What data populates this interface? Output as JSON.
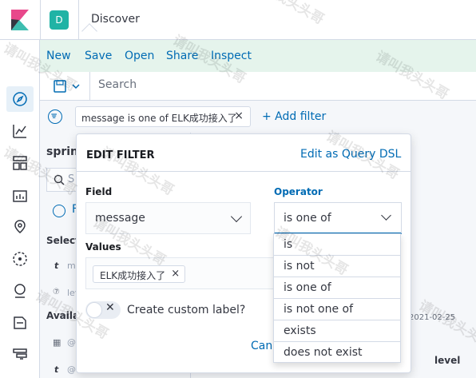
{
  "header": {
    "space_initial": "D",
    "page_title": "Discover"
  },
  "toolbar": {
    "new_label": "New",
    "save_label": "Save",
    "open_label": "Open",
    "share_label": "Share",
    "inspect_label": "Inspect"
  },
  "query_bar": {
    "placeholder": "Search"
  },
  "filter_bar": {
    "pill_text": "message is one of ELK成功接入了",
    "pill_close": "×",
    "add_filter_label": "+ Add filter"
  },
  "background": {
    "index_name": "spring",
    "search_glyph": "S",
    "filter_letter": "F",
    "selected_label": "Select",
    "field_type_t": "t",
    "field_m": "m",
    "field_type_q": "⑦",
    "field_lev": "lev",
    "available_label": "Availa",
    "date_type": "▦",
    "field_at1": "@",
    "field_type_t2": "t",
    "field_at2": "@",
    "date_text": "2021-02-25",
    "level_header": "level"
  },
  "edit_filter": {
    "title": "EDIT FILTER",
    "edit_dsl_label": "Edit as Query DSL",
    "field_label": "Field",
    "field_value": "message",
    "operator_label": "Operator",
    "operator_value": "is one of",
    "values_label": "Values",
    "value_chips": [
      "ELK成功接入了"
    ],
    "chip_close": "×",
    "toggle_off_glyph": "✕",
    "custom_label_text": "Create custom label?",
    "cancel_label": "Can"
  },
  "operator_options": [
    "is",
    "is not",
    "is one of",
    "is not one of",
    "exists",
    "does not exist"
  ],
  "watermark_text": "请叫我头头哥",
  "colors": {
    "accent": "#006bb4",
    "toolbar_bg": "#e5f4ec",
    "space_avatar": "#20b3a5",
    "logo_pink": "#e8488b",
    "logo_teal": "#3ebeb0"
  }
}
